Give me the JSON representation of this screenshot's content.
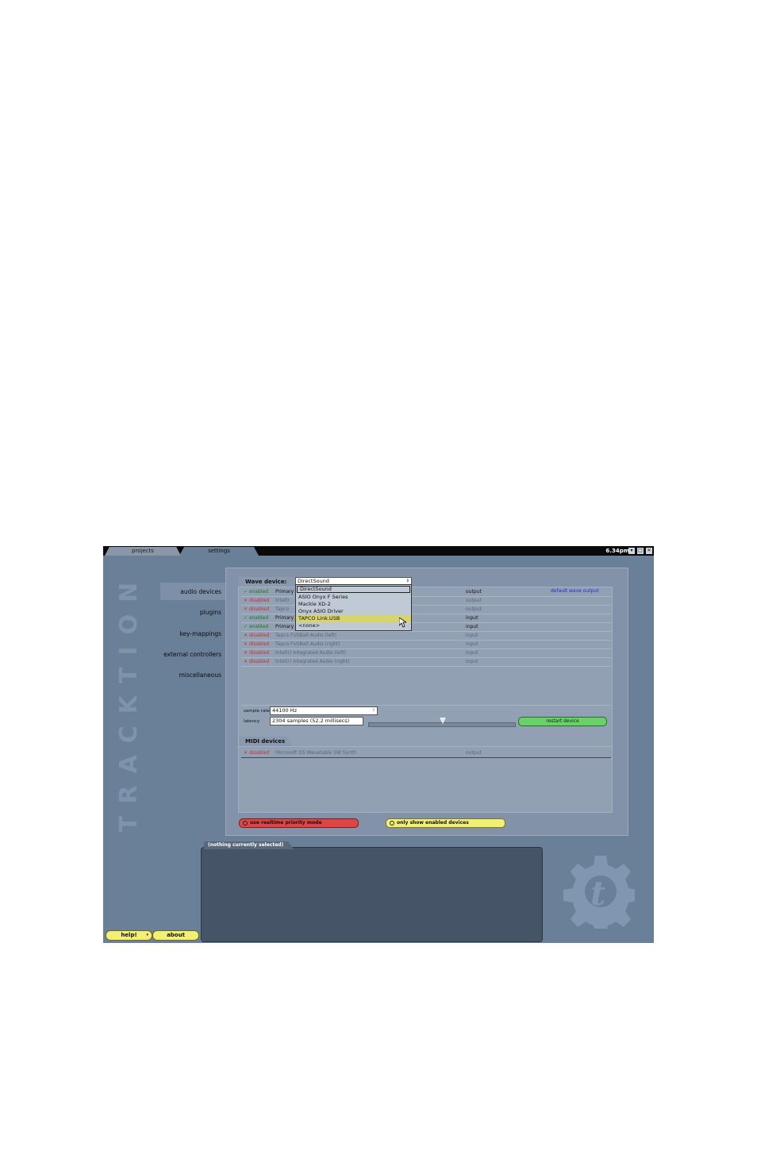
{
  "titlebar": {
    "tabs": [
      {
        "label": "projects"
      },
      {
        "label": "settings"
      }
    ],
    "clock": "6.34pm",
    "buttons": [
      "▾",
      "□",
      "✕"
    ]
  },
  "brand": "TRACKTION",
  "nav": {
    "items": [
      {
        "label": "audio devices",
        "active": true
      },
      {
        "label": "plugins"
      },
      {
        "label": "key-mappings"
      },
      {
        "label": "external controllers"
      },
      {
        "label": "miscellaneous"
      }
    ]
  },
  "wave": {
    "tab_label": "Wave device:",
    "selected_driver": "DirectSound",
    "default_label": "default wave output",
    "dropdown_options": [
      "DirectSound",
      "ASIO Onyx F Series",
      "Mackie XD-2",
      "Onyx ASIO Driver",
      "TAPCO Link.USB",
      "<none>"
    ],
    "dropdown_highlight": "TAPCO Link.USB",
    "rows": [
      {
        "status": "enabled",
        "name": "Primary",
        "io": "output"
      },
      {
        "status": "disabled",
        "name": "Intel(r",
        "io": "output"
      },
      {
        "status": "disabled",
        "name": "Tapco",
        "io": "output"
      },
      {
        "status": "enabled",
        "name": "Primary",
        "io": "input"
      },
      {
        "status": "enabled",
        "name": "Primary",
        "io": "input"
      },
      {
        "status": "disabled",
        "name": "Tapco FUSBall Audio (left)",
        "io": "input"
      },
      {
        "status": "disabled",
        "name": "Tapco FUSBall Audio (right)",
        "io": "input"
      },
      {
        "status": "disabled",
        "name": "Intel(r) Integrated Audio (left)",
        "io": "input"
      },
      {
        "status": "disabled",
        "name": "Intel(r) Integrated Audio (right)",
        "io": "input"
      }
    ],
    "sample_rate_label": "sample rate",
    "sample_rate_value": "44100 Hz",
    "latency_label": "latency",
    "latency_value": "2304 samples  (52.2 millisecs)",
    "latency_level": 0.5,
    "restart_label": "restart device"
  },
  "midi": {
    "tab_label": "MIDI devices",
    "rows": [
      {
        "status": "disabled",
        "name": "Microsoft GS Wavetable SW Synth",
        "io": "output"
      }
    ]
  },
  "options": {
    "realtime_label": "use realtime priority mode",
    "enabled_only_label": "only show enabled devices"
  },
  "info": {
    "tab_label": "(nothing currently selected)"
  },
  "footer": {
    "help_label": "help!",
    "help_arrow": "▾",
    "about_label": "about"
  }
}
